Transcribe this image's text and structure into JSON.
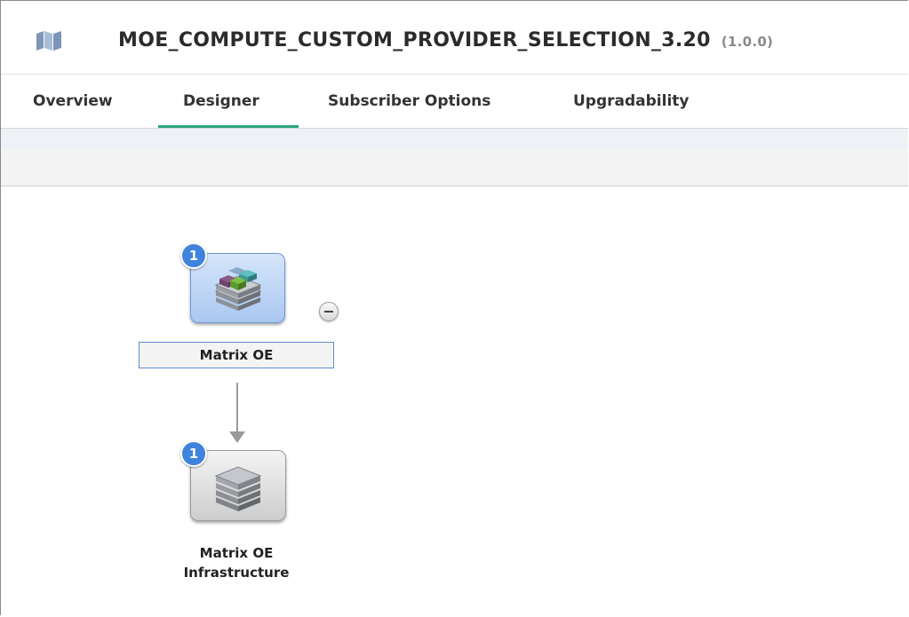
{
  "header": {
    "app_icon": "map-icon",
    "title": "MOE_COMPUTE_CUSTOM_PROVIDER_SELECTION_3.20",
    "version": "(1.0.0)"
  },
  "tabs": [
    {
      "label": "Overview",
      "active": false
    },
    {
      "label": "Designer",
      "active": true
    },
    {
      "label": "Subscriber Options",
      "active": false
    },
    {
      "label": "Upgradability",
      "active": false
    }
  ],
  "colors": {
    "accent_tab": "#2aa57a",
    "badge": "#3f83dd",
    "selected_border": "#5b8fd0"
  },
  "designer": {
    "nodes": [
      {
        "label": "Matrix OE",
        "badge": "1",
        "icon": "stacked-cubes-icon",
        "selected": true
      },
      {
        "label": "Matrix OE\nInfrastructure",
        "badge": "1",
        "icon": "server-stack-icon",
        "selected": false
      }
    ],
    "collapse_button_icon": "minus-icon",
    "connector": "down-arrow"
  }
}
